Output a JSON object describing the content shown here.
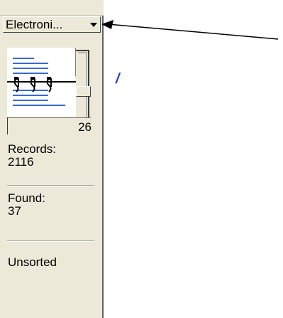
{
  "status_area": {
    "layout_menu": {
      "selected": "Electroni...",
      "icon": "chevron-down-icon"
    },
    "book": {
      "icon": "spiral-notebook-icon",
      "current_record": "26"
    },
    "records_label": "Records:",
    "records_value": "2116",
    "found_label": "Found:",
    "found_value": "37",
    "sort_status": "Unsorted"
  },
  "content": {
    "edge_glyph": "/"
  },
  "colors": {
    "panel_background": "#ECE9D8",
    "book_lines": "#3a6ad0",
    "link_blue": "#1f3fd0"
  }
}
